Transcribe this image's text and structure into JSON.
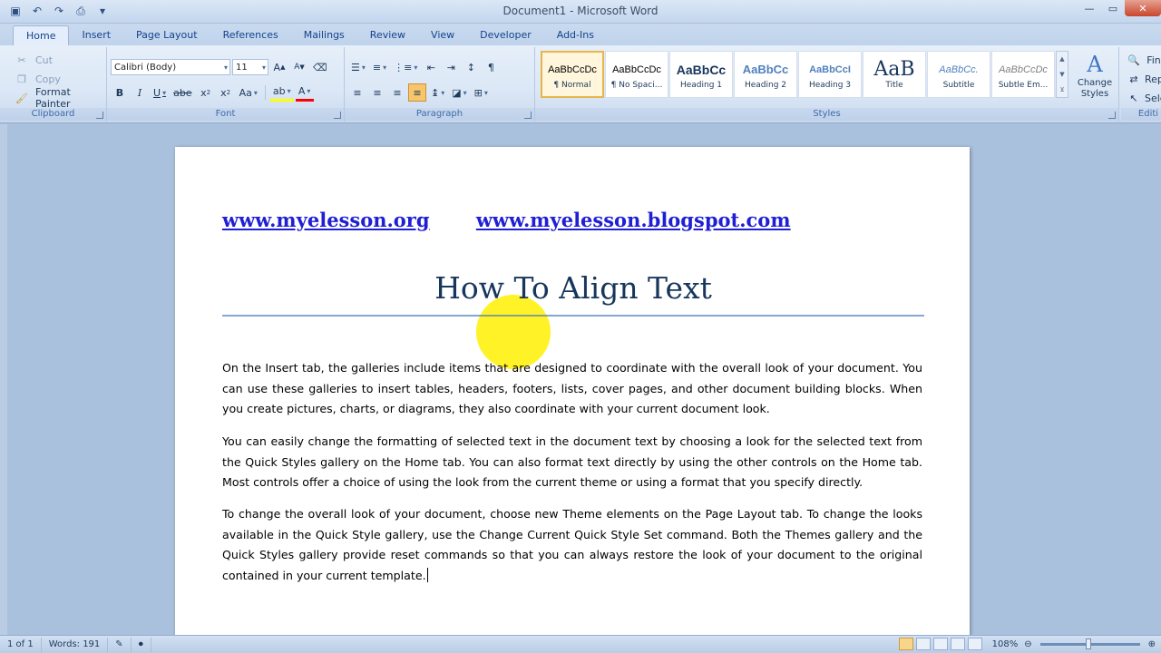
{
  "window": {
    "title": "Document1 - Microsoft Word"
  },
  "tabs": [
    {
      "label": "Home",
      "active": true
    },
    {
      "label": "Insert"
    },
    {
      "label": "Page Layout"
    },
    {
      "label": "References"
    },
    {
      "label": "Mailings"
    },
    {
      "label": "Review"
    },
    {
      "label": "View"
    },
    {
      "label": "Developer"
    },
    {
      "label": "Add-Ins"
    }
  ],
  "ribbon": {
    "clipboard": {
      "label": "Clipboard",
      "cut": "Cut",
      "copy": "Copy",
      "format_painter": "Format Painter"
    },
    "font": {
      "label": "Font",
      "font_name": "Calibri (Body)",
      "font_size": "11"
    },
    "paragraph": {
      "label": "Paragraph"
    },
    "styles": {
      "label": "Styles",
      "items": [
        {
          "sample": "AaBbCcDc",
          "name": "¶ Normal"
        },
        {
          "sample": "AaBbCcDc",
          "name": "¶ No Spaci..."
        },
        {
          "sample": "AaBbCc",
          "name": "Heading 1"
        },
        {
          "sample": "AaBbCc",
          "name": "Heading 2"
        },
        {
          "sample": "AaBbCcI",
          "name": "Heading 3"
        },
        {
          "sample": "AaB",
          "name": "Title"
        },
        {
          "sample": "AaBbCc.",
          "name": "Subtitle"
        },
        {
          "sample": "AaBbCcDc",
          "name": "Subtle Em..."
        }
      ],
      "change_styles": "Change Styles"
    },
    "editing": {
      "label": "Editi",
      "find": "Fin",
      "replace": "Rep",
      "select": "Sele"
    }
  },
  "document": {
    "link1": "www.myelesson.org",
    "link2": "www.myelesson.blogspot.com",
    "heading": "How To Align Text",
    "paragraphs": [
      "On the Insert tab, the galleries include items that are designed to coordinate with the overall look of your document. You can use these galleries to insert tables, headers, footers, lists, cover pages, and other document building blocks. When you create pictures, charts, or diagrams, they also coordinate with your current document look.",
      "You can easily change the formatting of selected text in the document text by choosing a look for the selected text from the Quick Styles gallery on the Home tab. You can also format text directly by using the other controls on the Home tab. Most controls offer a choice of using the look from the current theme or using a format that you specify directly.",
      "To change the overall look of your document, choose new Theme elements on the Page Layout tab. To change the looks available in the Quick Style gallery, use the Change Current Quick Style Set command. Both the Themes gallery and the Quick Styles gallery provide reset commands so that you can always restore the look of your document to the original contained in your current template."
    ]
  },
  "status": {
    "page": "1 of 1",
    "words": "Words: 191",
    "zoom": "108%"
  },
  "colors": {
    "link": "#1f1fd6",
    "heading": "#17365d",
    "ribbon_bg": "#dbe7f6"
  }
}
